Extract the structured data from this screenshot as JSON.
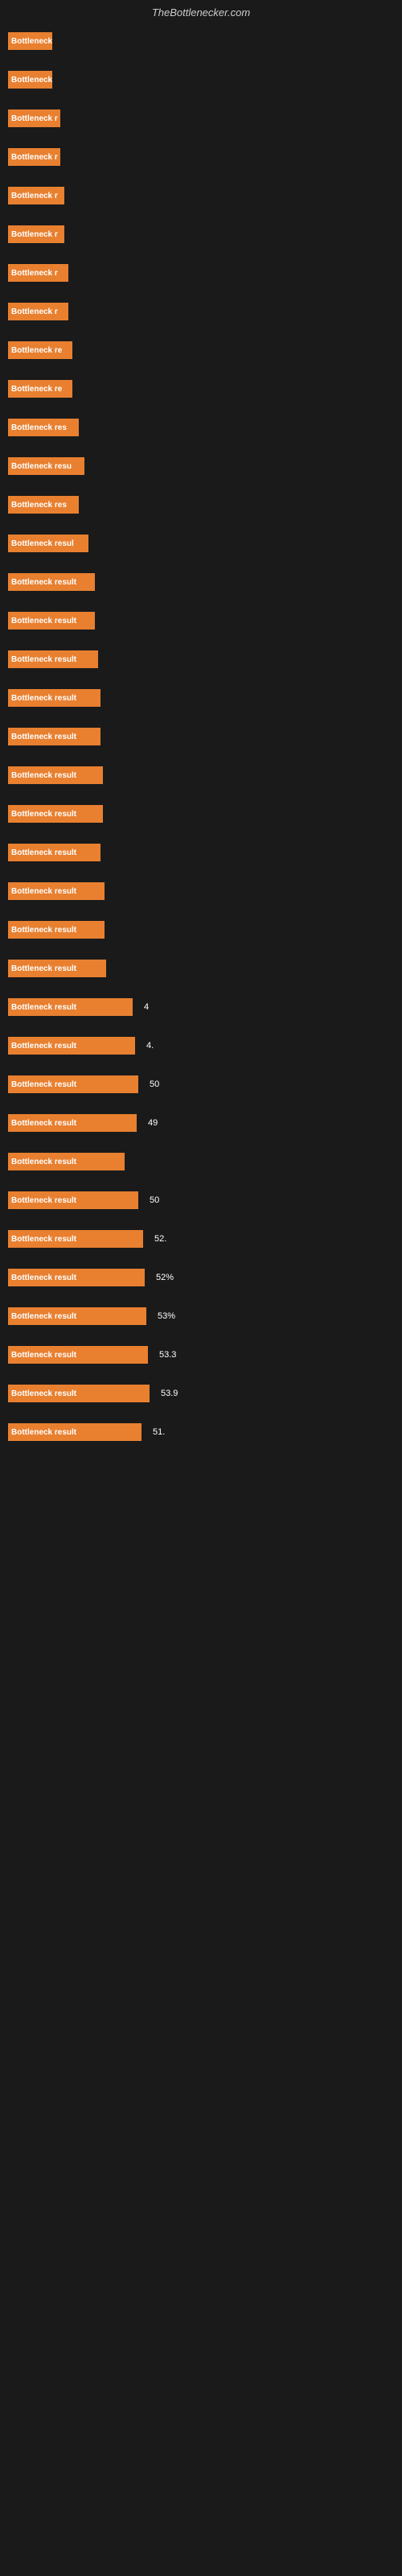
{
  "header": {
    "title": "TheBottlenecker.com"
  },
  "rows": [
    {
      "label": "Bottleneck",
      "width": 55,
      "value": "",
      "showValue": false
    },
    {
      "label": "Bottleneck",
      "width": 55,
      "value": "",
      "showValue": false
    },
    {
      "label": "Bottleneck r",
      "width": 65,
      "value": "",
      "showValue": false
    },
    {
      "label": "Bottleneck r",
      "width": 65,
      "value": "",
      "showValue": false
    },
    {
      "label": "Bottleneck r",
      "width": 70,
      "value": "",
      "showValue": false
    },
    {
      "label": "Bottleneck r",
      "width": 70,
      "value": "",
      "showValue": false
    },
    {
      "label": "Bottleneck r",
      "width": 75,
      "value": "",
      "showValue": false
    },
    {
      "label": "Bottleneck r",
      "width": 75,
      "value": "",
      "showValue": false
    },
    {
      "label": "Bottleneck re",
      "width": 80,
      "value": "",
      "showValue": false
    },
    {
      "label": "Bottleneck re",
      "width": 80,
      "value": "",
      "showValue": false
    },
    {
      "label": "Bottleneck res",
      "width": 88,
      "value": "",
      "showValue": false
    },
    {
      "label": "Bottleneck resu",
      "width": 95,
      "value": "",
      "showValue": false
    },
    {
      "label": "Bottleneck res",
      "width": 88,
      "value": "",
      "showValue": false
    },
    {
      "label": "Bottleneck resul",
      "width": 100,
      "value": "",
      "showValue": false
    },
    {
      "label": "Bottleneck result",
      "width": 108,
      "value": "",
      "showValue": false
    },
    {
      "label": "Bottleneck result",
      "width": 108,
      "value": "",
      "showValue": false
    },
    {
      "label": "Bottleneck result",
      "width": 112,
      "value": "",
      "showValue": false
    },
    {
      "label": "Bottleneck result",
      "width": 115,
      "value": "",
      "showValue": false
    },
    {
      "label": "Bottleneck result",
      "width": 115,
      "value": "",
      "showValue": false
    },
    {
      "label": "Bottleneck result",
      "width": 118,
      "value": "",
      "showValue": false
    },
    {
      "label": "Bottleneck result",
      "width": 118,
      "value": "",
      "showValue": false
    },
    {
      "label": "Bottleneck result",
      "width": 115,
      "value": "",
      "showValue": false
    },
    {
      "label": "Bottleneck result",
      "width": 120,
      "value": "",
      "showValue": false
    },
    {
      "label": "Bottleneck result",
      "width": 120,
      "value": "",
      "showValue": false
    },
    {
      "label": "Bottleneck result",
      "width": 122,
      "value": "",
      "showValue": false
    },
    {
      "label": "Bottleneck result",
      "width": 155,
      "value": "4",
      "showValue": true
    },
    {
      "label": "Bottleneck result",
      "width": 158,
      "value": "4.",
      "showValue": true
    },
    {
      "label": "Bottleneck result",
      "width": 162,
      "value": "50",
      "showValue": true
    },
    {
      "label": "Bottleneck result",
      "width": 160,
      "value": "49",
      "showValue": true
    },
    {
      "label": "Bottleneck result",
      "width": 145,
      "value": "",
      "showValue": true
    },
    {
      "label": "Bottleneck result",
      "width": 162,
      "value": "50",
      "showValue": true
    },
    {
      "label": "Bottleneck result",
      "width": 168,
      "value": "52.",
      "showValue": true
    },
    {
      "label": "Bottleneck result",
      "width": 170,
      "value": "52%",
      "showValue": true
    },
    {
      "label": "Bottleneck result",
      "width": 172,
      "value": "53%",
      "showValue": true
    },
    {
      "label": "Bottleneck result",
      "width": 174,
      "value": "53.3",
      "showValue": true
    },
    {
      "label": "Bottleneck result",
      "width": 176,
      "value": "53.9",
      "showValue": true
    },
    {
      "label": "Bottleneck result",
      "width": 166,
      "value": "51.",
      "showValue": true
    }
  ]
}
